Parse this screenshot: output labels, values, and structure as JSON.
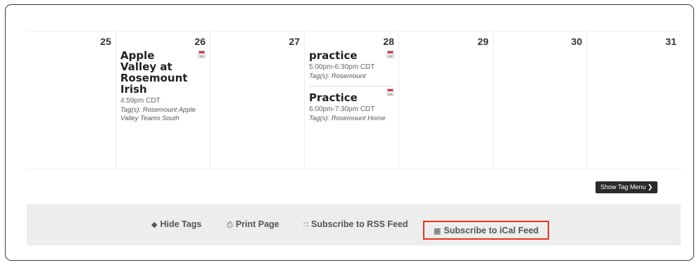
{
  "calendar": {
    "days": [
      {
        "num": "25",
        "events": []
      },
      {
        "num": "26",
        "events": [
          {
            "title": "Apple Valley at Rosemount Irish",
            "time": "4:59pm CDT",
            "tags": "Tag(s): Rosemount Apple Valley Teams South"
          }
        ]
      },
      {
        "num": "27",
        "events": []
      },
      {
        "num": "28",
        "events": [
          {
            "title": "practice",
            "time": "5:00pm-6:30pm CDT",
            "tags": "Tag(s): Rosemount"
          },
          {
            "title": "Practice",
            "time": "6:00pm-7:30pm CDT",
            "tags": "Tag(s): Rosemount Home"
          }
        ]
      },
      {
        "num": "29",
        "events": []
      },
      {
        "num": "30",
        "events": []
      },
      {
        "num": "31",
        "events": []
      }
    ]
  },
  "show_tag_menu_label": "Show Tag Menu",
  "toolbar": {
    "hide_tags": "Hide Tags",
    "print_page": "Print Page",
    "rss": "Subscribe to RSS Feed",
    "ical": "Subscribe to iCal Feed"
  },
  "colors": {
    "highlight": "#e8341c",
    "toolbar_bg": "#ededed",
    "button_dark": "#2b2b2b"
  }
}
